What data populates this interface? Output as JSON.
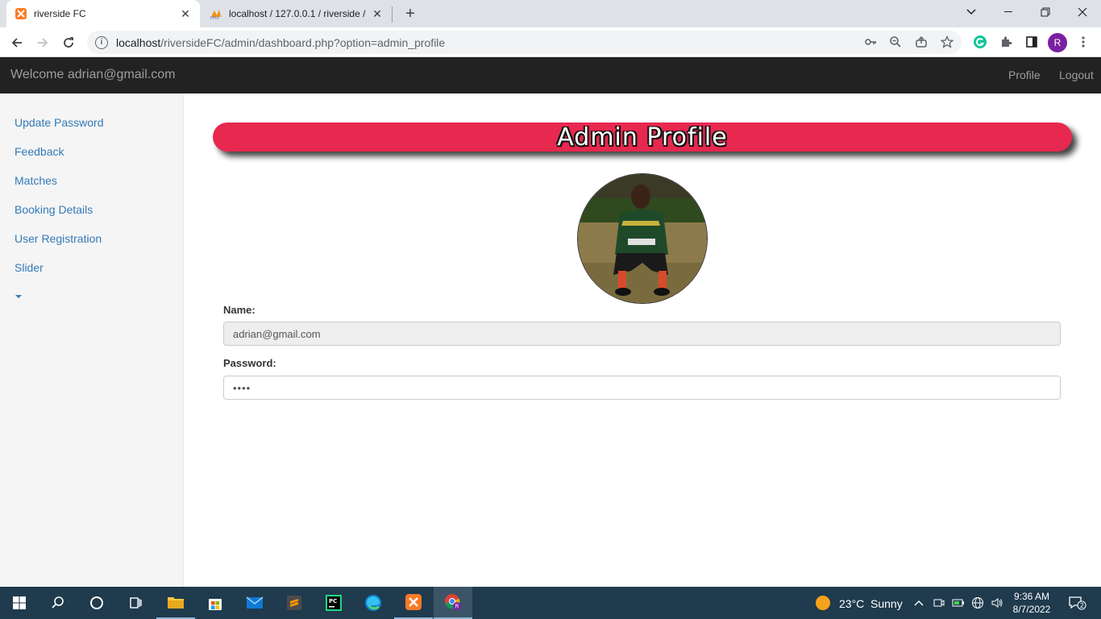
{
  "browser": {
    "tabs": [
      {
        "title": "riverside FC",
        "active": true
      },
      {
        "title": "localhost / 127.0.0.1 / riverside / ",
        "active": false
      }
    ],
    "address": {
      "host": "localhost",
      "path": "/riversideFC/admin/dashboard.php?option=admin_profile"
    },
    "profile_initial": "R"
  },
  "header": {
    "welcome": "Welcome adrian@gmail.com",
    "nav": [
      "Profile",
      "Logout"
    ]
  },
  "sidebar": {
    "items": [
      {
        "label": "Update Password"
      },
      {
        "label": "Feedback"
      },
      {
        "label": "Matches"
      },
      {
        "label": "Booking Details"
      },
      {
        "label": "User Registration"
      },
      {
        "label": "Slider"
      }
    ]
  },
  "main": {
    "banner_title": "Admin Profile",
    "name_label": "Name:",
    "name_value": "adrian@gmail.com",
    "password_label": "Password:",
    "password_value": "••••",
    "banner_color": "#e7284f"
  },
  "taskbar": {
    "weather_temp": "23°C",
    "weather_desc": "Sunny",
    "time": "9:36 AM",
    "date": "8/7/2022",
    "notification_count": "2"
  }
}
